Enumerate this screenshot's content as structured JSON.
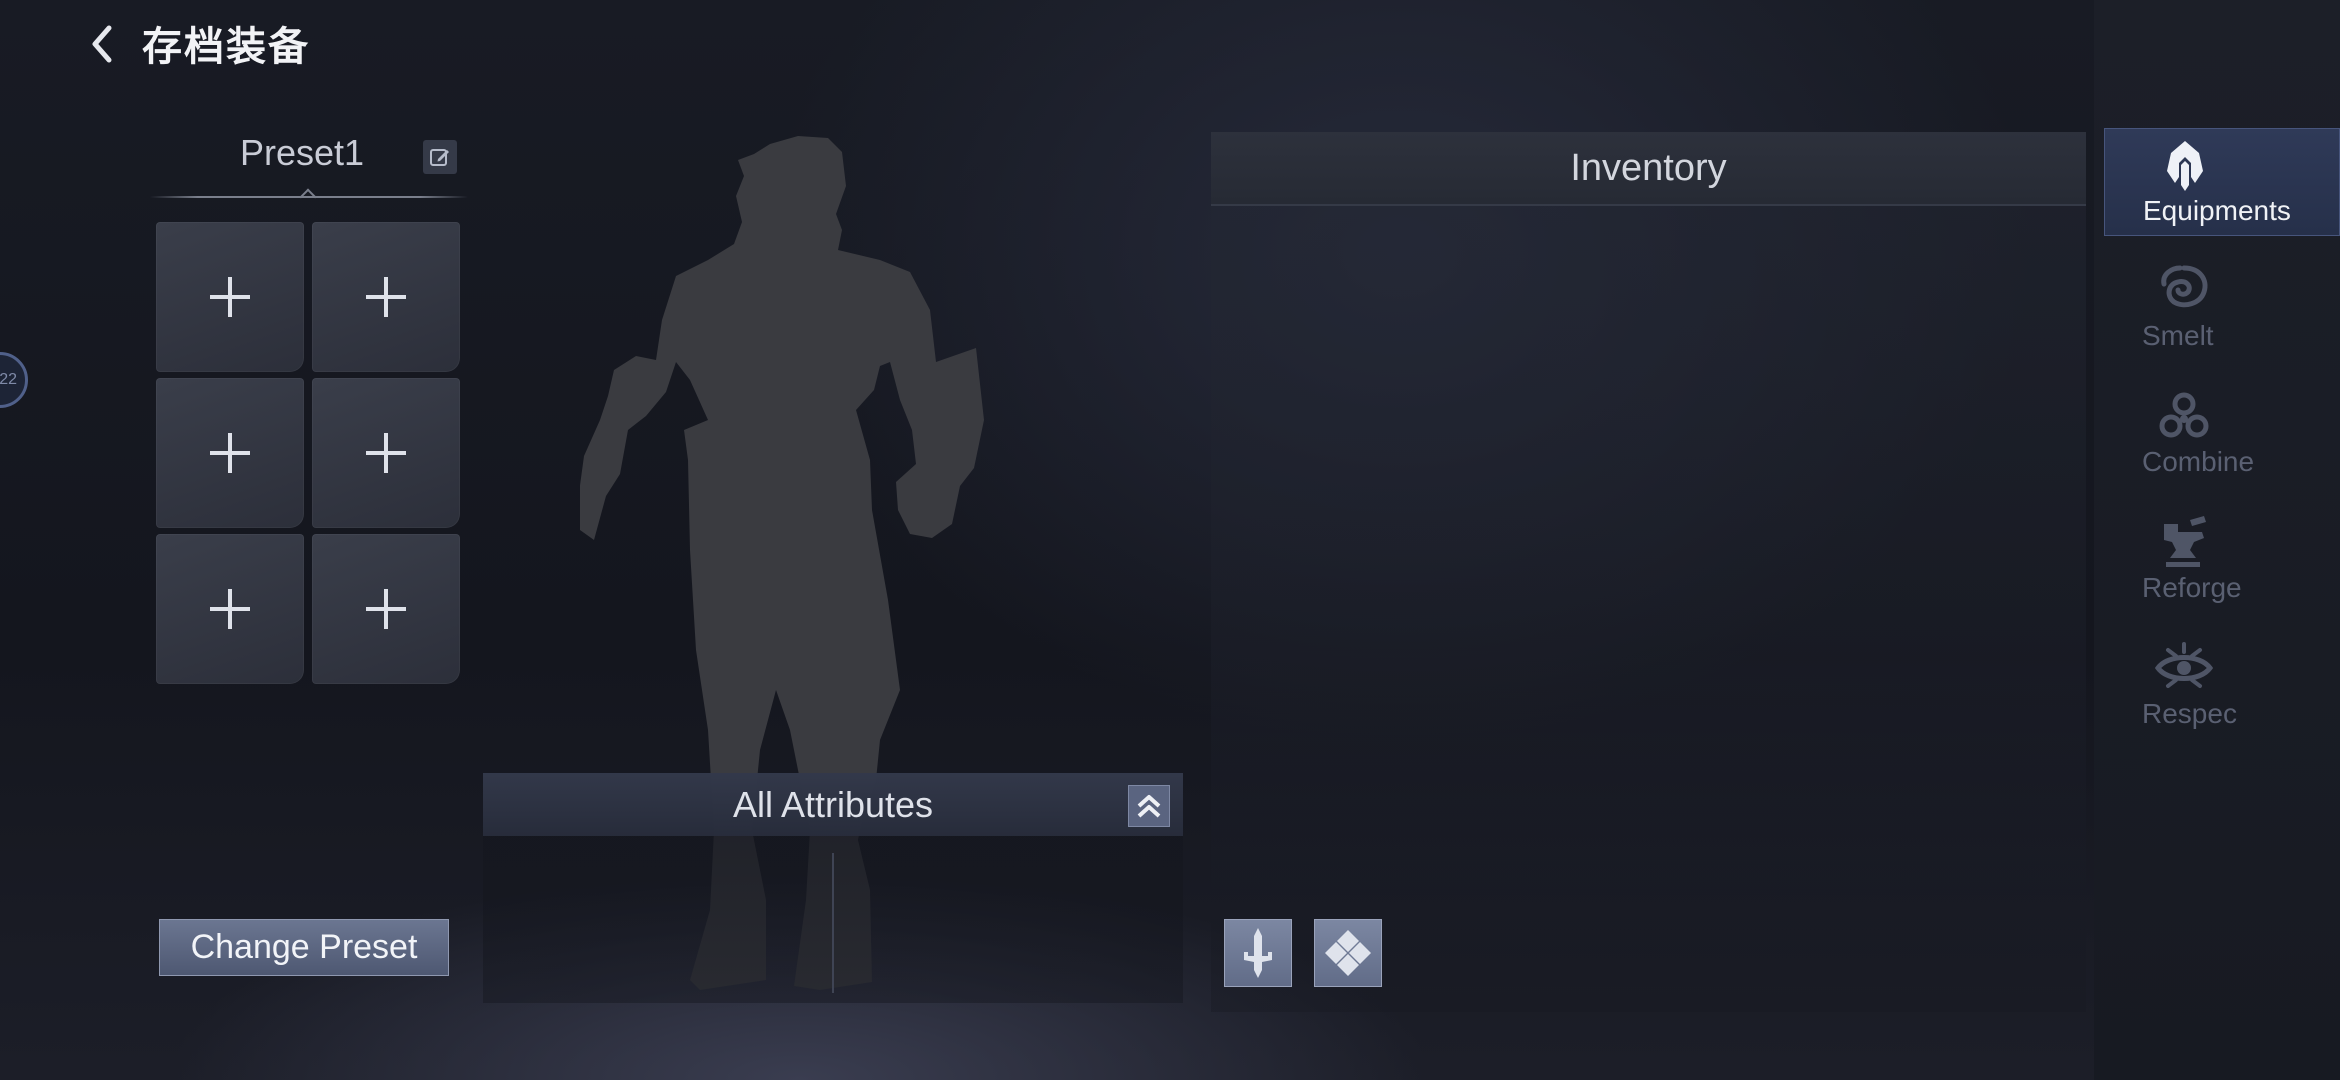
{
  "header": {
    "title": "存档装备"
  },
  "side_bubble": {
    "text": "22"
  },
  "preset": {
    "name": "Preset1",
    "slots": [
      "+",
      "+",
      "+",
      "+",
      "+",
      "+"
    ],
    "change_label": "Change Preset"
  },
  "attributes": {
    "title": "All Attributes"
  },
  "inventory": {
    "title": "Inventory"
  },
  "nav": {
    "items": [
      {
        "label": "Equipments",
        "icon": "helmet-icon",
        "active": true
      },
      {
        "label": "Smelt",
        "icon": "swirl-icon",
        "active": false
      },
      {
        "label": "Combine",
        "icon": "combine-icon",
        "active": false
      },
      {
        "label": "Reforge",
        "icon": "anvil-icon",
        "active": false
      },
      {
        "label": "Respec",
        "icon": "respec-eye-icon",
        "active": false
      }
    ]
  },
  "colors": {
    "accent": "#4e5872",
    "active_nav": "#2f3a58",
    "inactive_text": "#5a6072"
  }
}
